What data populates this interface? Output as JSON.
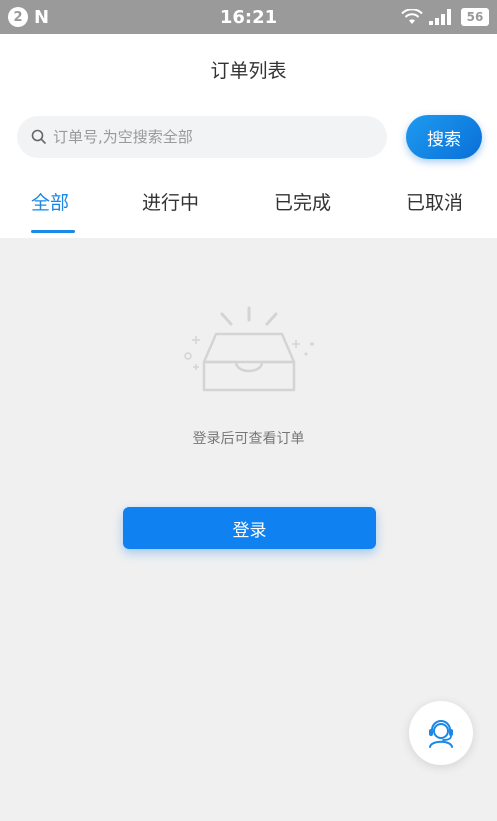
{
  "statusbar": {
    "notification_count": "2",
    "time": "16:21",
    "battery": "56"
  },
  "page": {
    "title": "订单列表"
  },
  "search": {
    "placeholder": "订单号,为空搜索全部",
    "value": "",
    "button_label": "搜索"
  },
  "tabs": [
    {
      "label": "全部",
      "active": true
    },
    {
      "label": "进行中",
      "active": false
    },
    {
      "label": "已完成",
      "active": false
    },
    {
      "label": "已取消",
      "active": false
    }
  ],
  "empty_state": {
    "message": "登录后可查看订单",
    "icon": "empty-box-icon"
  },
  "login_button": {
    "label": "登录"
  },
  "support_fab": {
    "icon": "customer-service-icon"
  },
  "colors": {
    "accent": "#1a88e6",
    "button": "#1081f0",
    "statusbar": "#9a9a9a",
    "background": "#f0f0f0"
  }
}
